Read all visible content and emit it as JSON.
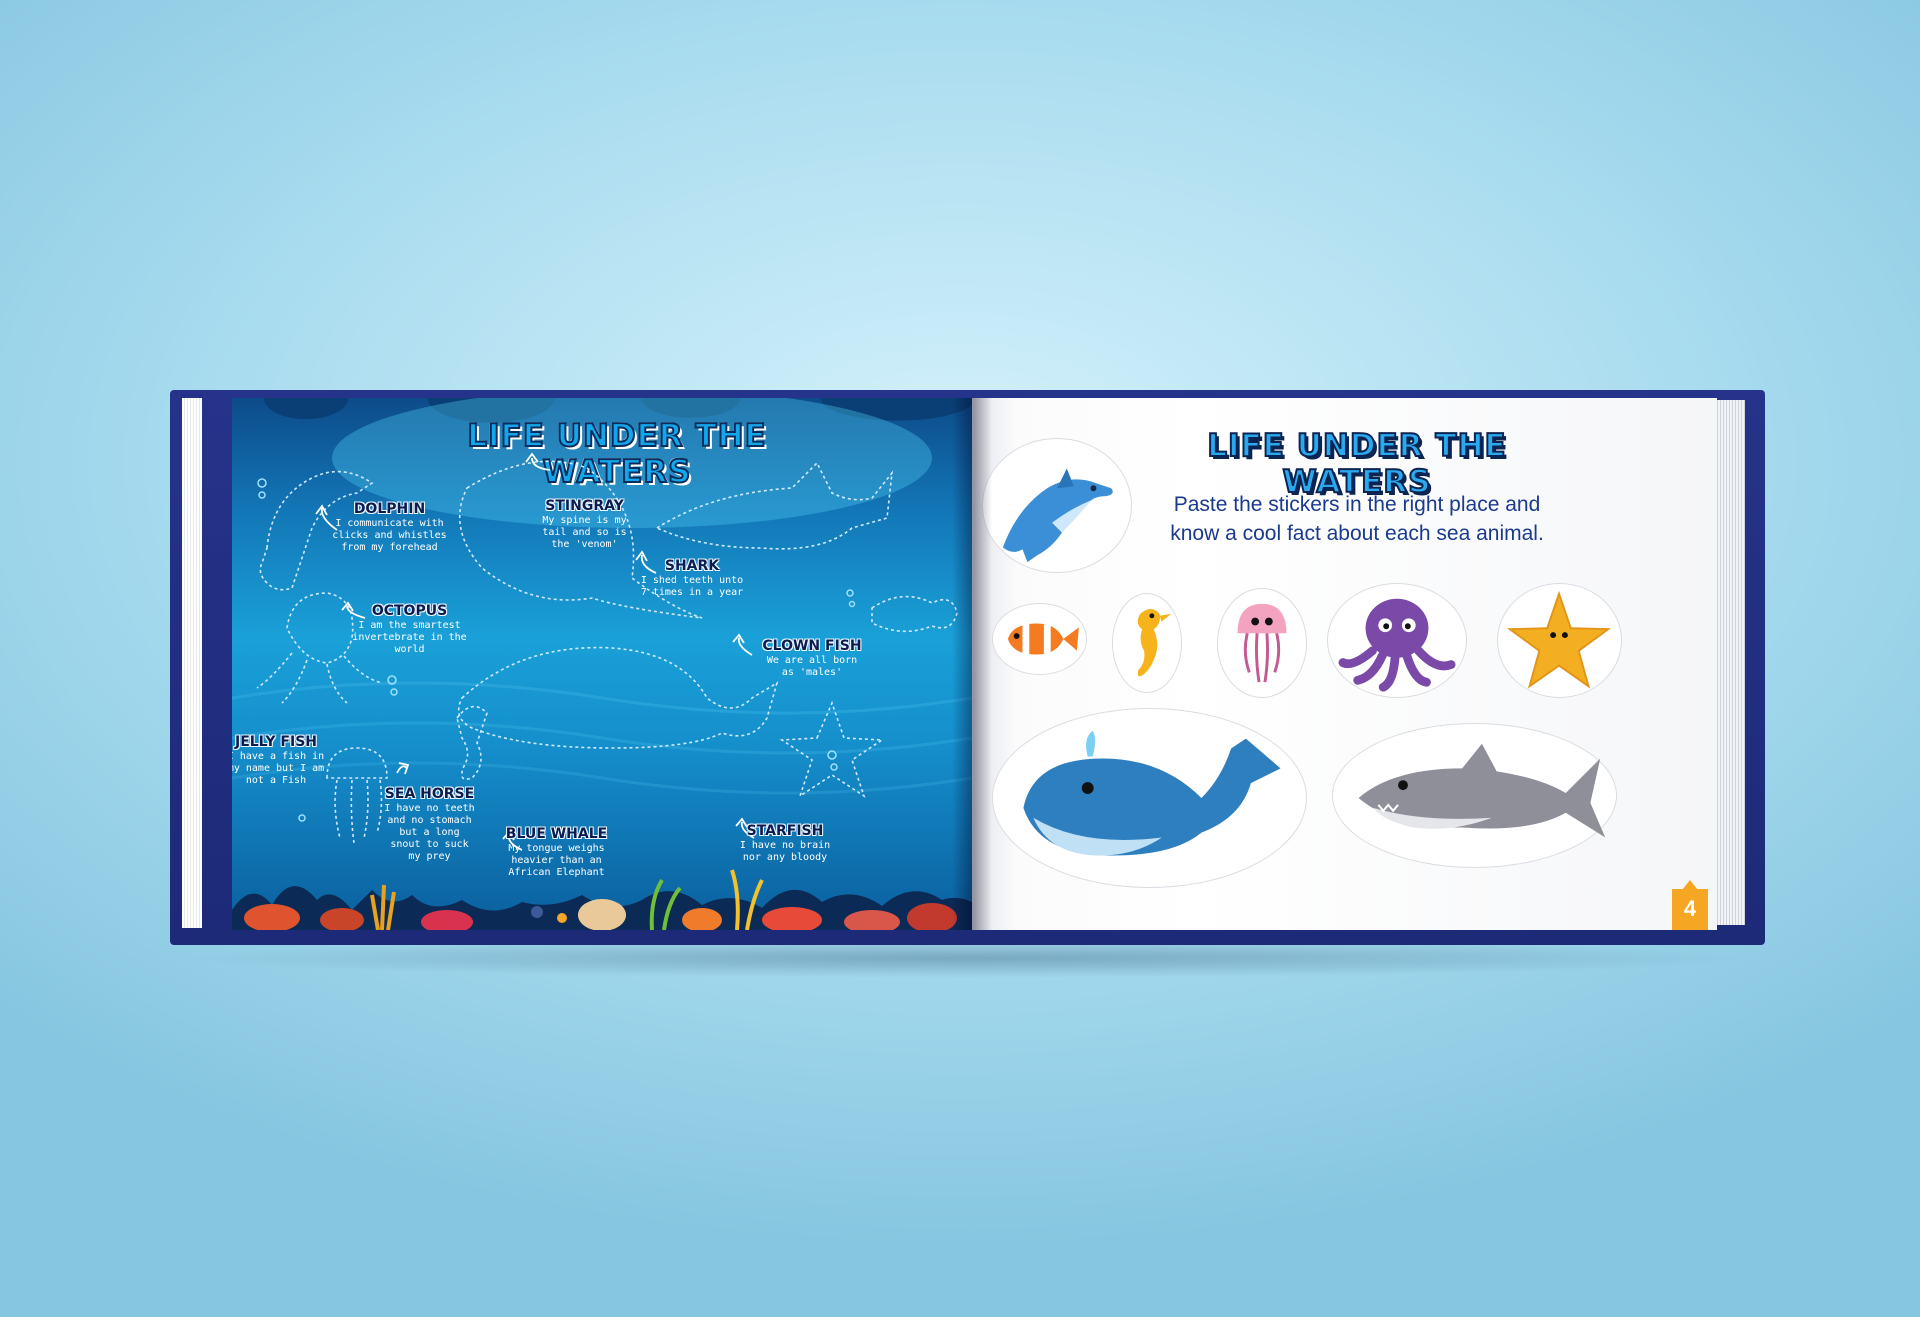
{
  "left_page": {
    "title": "LIFE UNDER THE WATERS",
    "animals": [
      {
        "name": "DOLPHIN",
        "fact": "I communicate with clicks and whistles from my forehead"
      },
      {
        "name": "STINGRAY",
        "fact": "My spine is my tail and so is the 'venom'"
      },
      {
        "name": "SHARK",
        "fact": "I shed teeth unto 7 times in a year"
      },
      {
        "name": "OCTOPUS",
        "fact": "I am the smartest invertebrate in the world"
      },
      {
        "name": "CLOWN FISH",
        "fact": "We are all born as 'males'"
      },
      {
        "name": "JELLY FISH",
        "fact": "I have a fish in my name but I am not a Fish"
      },
      {
        "name": "SEA HORSE",
        "fact": "I have no teeth and no stomach but a long snout to suck my prey"
      },
      {
        "name": "BLUE WHALE",
        "fact": "My tongue weighs heavier than an African Elephant"
      },
      {
        "name": "STARFISH",
        "fact": "I have no brain nor any bloody"
      }
    ]
  },
  "right_page": {
    "title": "LIFE UNDER THE WATERS",
    "instruction": "Paste the stickers in the right place and know a cool fact about each sea animal.",
    "page_number": "4"
  },
  "colors": {
    "background": "#a9dcef",
    "cover": "#25338a",
    "title_fill": "#12a7ea",
    "title_outline": "#0b2452",
    "instruction_text": "#1a3a8e",
    "page_tab": "#f5a623"
  },
  "icons": [
    "dolphin-sticker-icon",
    "clownfish-sticker-icon",
    "seahorse-sticker-icon",
    "jellyfish-sticker-icon",
    "octopus-sticker-icon",
    "starfish-sticker-icon",
    "whale-sticker-icon",
    "shark-sticker-icon"
  ]
}
